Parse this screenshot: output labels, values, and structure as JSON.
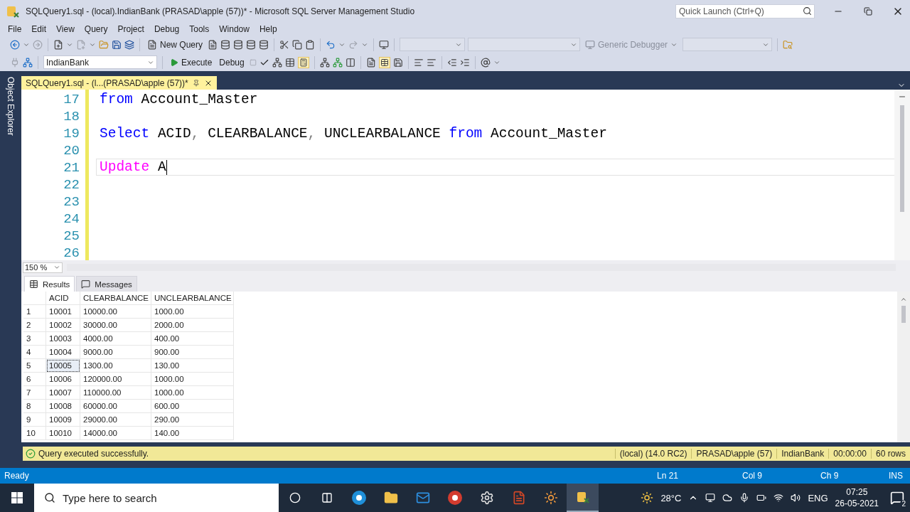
{
  "window": {
    "title": "SQLQuery1.sql - (local).IndianBank (PRASAD\\apple (57))* - Microsoft SQL Server Management Studio"
  },
  "quick_launch": {
    "placeholder": "Quick Launch (Ctrl+Q)"
  },
  "menu": [
    "File",
    "Edit",
    "View",
    "Query",
    "Project",
    "Debug",
    "Tools",
    "Window",
    "Help"
  ],
  "toolbar": {
    "new_query": "New Query",
    "debugger": "Generic Debugger",
    "database": "IndianBank",
    "execute": "Execute",
    "debug": "Debug"
  },
  "side_panel": {
    "label": "Object Explorer"
  },
  "document_tab": {
    "title": "SQLQuery1.sql - (l...(PRASAD\\apple (57))*",
    "selected": true
  },
  "editor": {
    "lines": [
      {
        "number": "17",
        "current": false,
        "tokens": [
          {
            "text": "from",
            "kind": "keyword"
          },
          {
            "text": " Account_Master",
            "kind": "plain"
          }
        ]
      },
      {
        "number": "18",
        "current": false
      },
      {
        "number": "19",
        "current": false,
        "tokens": [
          {
            "text": "Select",
            "kind": "keyword"
          },
          {
            "text": " ACID",
            "kind": "plain"
          },
          {
            "text": ",",
            "kind": "punct"
          },
          {
            "text": " CLEARBALANCE",
            "kind": "plain"
          },
          {
            "text": ",",
            "kind": "punct"
          },
          {
            "text": " UNCLEARBALANCE ",
            "kind": "plain"
          },
          {
            "text": "from",
            "kind": "keyword"
          },
          {
            "text": " Account_Master",
            "kind": "plain"
          }
        ]
      },
      {
        "number": "20",
        "current": false
      },
      {
        "number": "21",
        "current": true,
        "tokens": [
          {
            "text": "Update",
            "kind": "statement"
          },
          {
            "text": " A",
            "kind": "plain"
          }
        ]
      },
      {
        "number": "22",
        "current": false
      },
      {
        "number": "23",
        "current": false
      },
      {
        "number": "24",
        "current": false
      },
      {
        "number": "25",
        "current": false
      },
      {
        "number": "26",
        "current": false
      }
    ]
  },
  "zoom": {
    "value": "150 %"
  },
  "result_tabs": [
    {
      "label": "Results",
      "kind": "grid",
      "selected": true
    },
    {
      "label": "Messages",
      "kind": "messages",
      "selected": false
    }
  ],
  "grid": {
    "columns": [
      "ACID",
      "CLEARBALANCE",
      "UNCLEARBALANCE"
    ],
    "rows": [
      {
        "number": "1",
        "selected": false,
        "cells": [
          "10001",
          "10000.00",
          "1000.00"
        ]
      },
      {
        "number": "2",
        "selected": false,
        "cells": [
          "10002",
          "30000.00",
          "2000.00"
        ]
      },
      {
        "number": "3",
        "selected": false,
        "cells": [
          "10003",
          "4000.00",
          "400.00"
        ]
      },
      {
        "number": "4",
        "selected": false,
        "cells": [
          "10004",
          "9000.00",
          "900.00"
        ]
      },
      {
        "number": "5",
        "selected": true,
        "cells": [
          "10005",
          "1300.00",
          "130.00"
        ]
      },
      {
        "number": "6",
        "selected": false,
        "cells": [
          "10006",
          "120000.00",
          "1000.00"
        ]
      },
      {
        "number": "7",
        "selected": false,
        "cells": [
          "10007",
          "110000.00",
          "1000.00"
        ]
      },
      {
        "number": "8",
        "selected": false,
        "cells": [
          "10008",
          "60000.00",
          "600.00"
        ]
      },
      {
        "number": "9",
        "selected": false,
        "cells": [
          "10009",
          "29000.00",
          "290.00"
        ]
      },
      {
        "number": "10",
        "selected": false,
        "cells": [
          "10010",
          "14000.00",
          "140.00"
        ]
      }
    ]
  },
  "query_status": {
    "message": "Query executed successfully.",
    "fields": [
      "(local) (14.0 RC2)",
      "PRASAD\\apple (57)",
      "IndianBank",
      "00:00:00",
      "60 rows"
    ]
  },
  "status_bar": {
    "state": "Ready",
    "line": "Ln 21",
    "column": "Col 9",
    "char": "Ch 9",
    "mode": "INS"
  },
  "taskbar": {
    "search_placeholder": "Type here to search",
    "temperature": "28°C",
    "language": "ENG",
    "time": "07:25",
    "date": "26-05-2021",
    "notifications": "2"
  }
}
